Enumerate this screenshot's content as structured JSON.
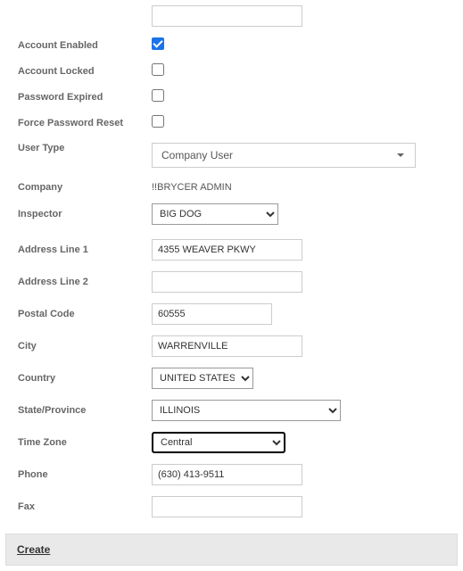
{
  "fields": {
    "accountEnabled": {
      "label": "Account Enabled",
      "checked": true
    },
    "accountLocked": {
      "label": "Account Locked",
      "checked": false
    },
    "passwordExpired": {
      "label": "Password Expired",
      "checked": false
    },
    "forcePasswordReset": {
      "label": "Force Password Reset",
      "checked": false
    },
    "userType": {
      "label": "User Type",
      "value": "Company User"
    },
    "company": {
      "label": "Company",
      "value": "!!BRYCER ADMIN"
    },
    "inspector": {
      "label": "Inspector",
      "value": "BIG DOG"
    },
    "address1": {
      "label": "Address Line 1",
      "value": "4355 WEAVER PKWY"
    },
    "address2": {
      "label": "Address Line 2",
      "value": ""
    },
    "postalCode": {
      "label": "Postal Code",
      "value": "60555"
    },
    "city": {
      "label": "City",
      "value": "WARRENVILLE"
    },
    "country": {
      "label": "Country",
      "value": "UNITED STATES"
    },
    "state": {
      "label": "State/Province",
      "value": "ILLINOIS"
    },
    "timeZone": {
      "label": "Time Zone",
      "value": "Central"
    },
    "phone": {
      "label": "Phone",
      "value": "(630) 413-9511"
    },
    "fax": {
      "label": "Fax",
      "value": ""
    }
  },
  "footer": {
    "createLabel": "Create"
  }
}
